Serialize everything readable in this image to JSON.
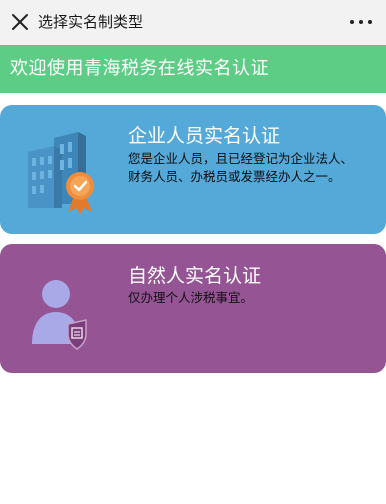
{
  "navbar": {
    "title": "选择实名制类型",
    "close_icon": "close-icon",
    "more_icon": "more-icon"
  },
  "banner": {
    "text": "欢迎使用青海税务在线实名认证"
  },
  "cards": [
    {
      "id": "enterprise",
      "title": "企业人员实名认证",
      "description": "您是企业人员，且已经登记为企业法人、财务人员、办税员或发票经办人之一。",
      "icon": "building-badge-icon",
      "color": "#54a9d9"
    },
    {
      "id": "natural",
      "title": "自然人实名认证",
      "description": "仅办理个人涉税事宜。",
      "icon": "person-badge-icon",
      "color": "#955595"
    }
  ],
  "colors": {
    "banner": "#5dcd86",
    "navbar": "#f2f2f2"
  }
}
